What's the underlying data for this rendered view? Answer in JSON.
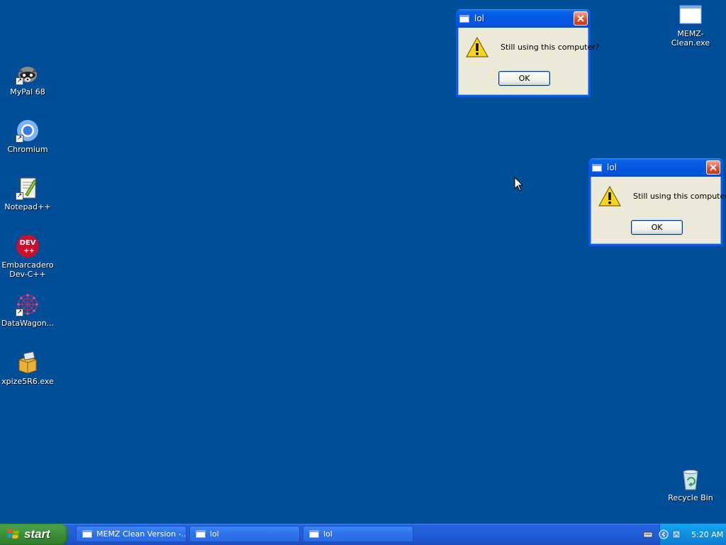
{
  "desktop": {
    "icons": [
      {
        "label": "MyPal 68"
      },
      {
        "label": "Chromium"
      },
      {
        "label": "Notepad++"
      },
      {
        "label": "Embarcadero Dev-C++",
        "logo_text": "DEV"
      },
      {
        "label": "DataWagon..."
      },
      {
        "label": "xpize5R6.exe"
      },
      {
        "label": "MEMZ-Clean.exe"
      },
      {
        "label": "Recycle Bin"
      }
    ]
  },
  "dialogs": [
    {
      "title": "lol",
      "message": "Still using this computer?",
      "ok_label": "OK"
    },
    {
      "title": "lol",
      "message": "Still using this computer?",
      "ok_label": "OK"
    }
  ],
  "taskbar": {
    "start_label": "start",
    "tasks": [
      {
        "label": "MEMZ Clean Version -..."
      },
      {
        "label": "lol"
      },
      {
        "label": "lol"
      }
    ],
    "clock": "5:20 AM"
  },
  "colors": {
    "desktop_bg": "#004e98",
    "taskbar_blue": "#225ed8",
    "start_green": "#3c8f3a",
    "dialog_bg": "#ece9d8",
    "close_red": "#df4a28"
  }
}
